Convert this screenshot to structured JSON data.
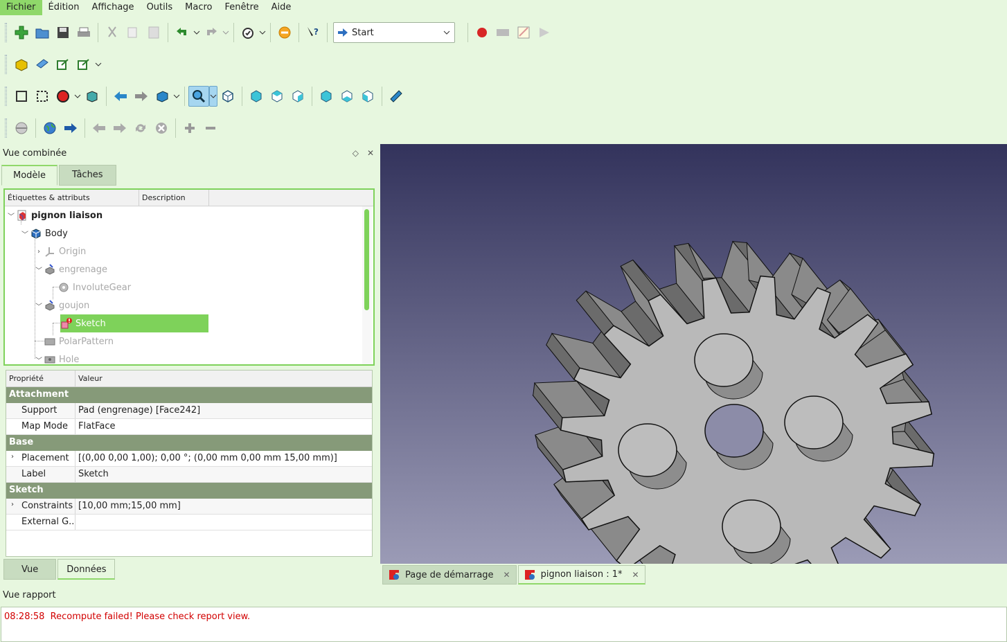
{
  "menu": [
    "Fichier",
    "Édition",
    "Affichage",
    "Outils",
    "Macro",
    "Fenêtre",
    "Aide"
  ],
  "toolbar": {
    "workbench": "Start"
  },
  "combo_view": {
    "title": "Vue combinée",
    "tabs": [
      "Modèle",
      "Tâches"
    ],
    "tree_headers": [
      "Étiquettes & attributs",
      "Description"
    ],
    "tree": [
      {
        "label": "pignon liaison",
        "style": "bold"
      },
      {
        "label": "Body"
      },
      {
        "label": "Origin",
        "style": "muted"
      },
      {
        "label": "engrenage",
        "style": "muted"
      },
      {
        "label": "InvoluteGear",
        "style": "muted"
      },
      {
        "label": "goujon",
        "style": "muted"
      },
      {
        "label": "Sketch",
        "style": "selected"
      },
      {
        "label": "PolarPattern",
        "style": "muted"
      },
      {
        "label": "Hole",
        "style": "muted"
      }
    ],
    "prop_headers": [
      "Propriété",
      "Valeur"
    ],
    "groups": [
      {
        "name": "Attachment",
        "rows": [
          {
            "name": "Support",
            "value": "Pad (engrenage) [Face242]"
          },
          {
            "name": "Map Mode",
            "value": "FlatFace"
          }
        ]
      },
      {
        "name": "Base",
        "rows": [
          {
            "name": "Placement",
            "value": "[(0,00 0,00 1,00); 0,00 °; (0,00 mm  0,00 mm  15,00 mm)]"
          },
          {
            "name": "Label",
            "value": "Sketch"
          }
        ]
      },
      {
        "name": "Sketch",
        "rows": [
          {
            "name": "Constraints",
            "value": "[10,00 mm;15,00 mm]"
          },
          {
            "name": "External G...",
            "value": ""
          }
        ]
      }
    ],
    "bottom_tabs": [
      "Vue",
      "Données"
    ]
  },
  "doc_tabs": [
    "Page de démarrage",
    "pignon liaison : 1*"
  ],
  "report": {
    "title": "Vue rapport",
    "time": "08:28:58",
    "message": "Recompute failed! Please check report view."
  },
  "colors": {
    "accent": "#7ed25a",
    "error": "#d20000",
    "group": "#869a79"
  }
}
